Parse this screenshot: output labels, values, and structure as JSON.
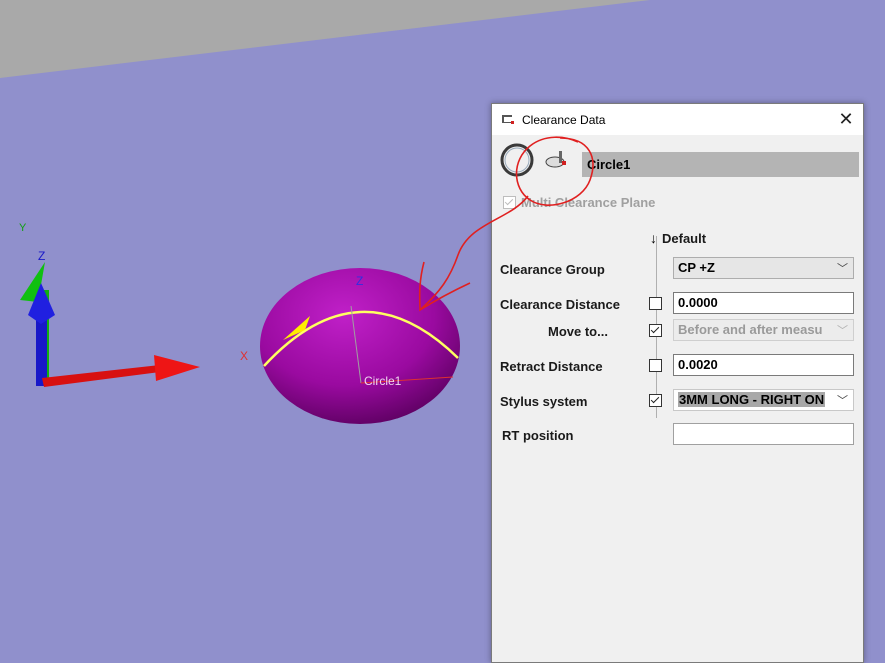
{
  "viewport": {
    "axis_triad": {
      "x": "X",
      "y": "Y",
      "z": "Z"
    },
    "feature_axes": {
      "x": "X",
      "z": "Z"
    },
    "feature_label": "Circle1"
  },
  "dialog": {
    "title": "Clearance Data",
    "close_glyph": "✕",
    "feature_name": "Circle1",
    "multi_clearance_plane": {
      "label": "Multi Clearance Plane",
      "checked": true,
      "enabled": false
    },
    "default_header": "Default",
    "rows": {
      "clearance_group": {
        "label": "Clearance Group",
        "value": "CP +Z"
      },
      "clearance_distance": {
        "label": "Clearance Distance",
        "checked": false,
        "value": "0.0000"
      },
      "move_to": {
        "label": "Move to...",
        "checked": true,
        "value": "Before and after measu",
        "enabled": false
      },
      "retract_distance": {
        "label": "Retract Distance",
        "checked": false,
        "value": "0.0020"
      },
      "stylus_system": {
        "label": "Stylus system",
        "checked": true,
        "value": "3MM LONG - RIGHT ON"
      },
      "rt_position": {
        "label": "RT position",
        "value": ""
      }
    }
  },
  "annotation": {
    "color": "#e02020",
    "shape": "circle-and-arrow"
  },
  "icons": [
    "circle-feature-icon",
    "clearance-probe-icon",
    "dialog-app-icon",
    "close-icon",
    "chevron-down-icon"
  ],
  "colors": {
    "viewport_bg": "#9090cc",
    "backdrop": "#a9a9a9",
    "sphere": "#b000b0",
    "highlight_circle": "#ffff60"
  }
}
